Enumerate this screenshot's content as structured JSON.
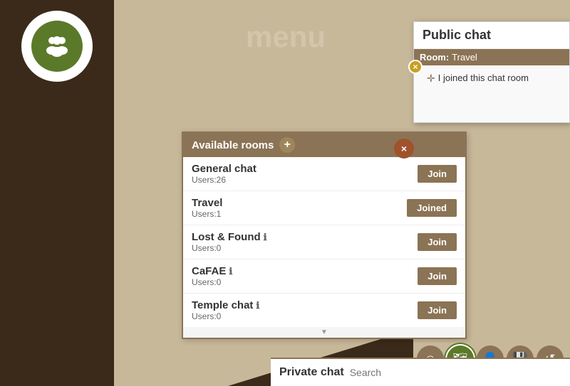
{
  "sidebar": {
    "logo_alt": "chat group icon"
  },
  "menu": {
    "title": "menu"
  },
  "public_chat": {
    "title": "Public chat",
    "room_label": "Room:",
    "room_name": "Travel",
    "message": "I joined this chat room",
    "close_x": "×",
    "dismiss_x": "×"
  },
  "rooms": {
    "header": "Available rooms",
    "add_icon": "+",
    "items": [
      {
        "name": "General chat",
        "users": "Users:26",
        "action": "Join",
        "joined": false,
        "info": false
      },
      {
        "name": "Travel",
        "users": "Users:1",
        "action": "Joined",
        "joined": true,
        "info": false
      },
      {
        "name": "Lost & Found",
        "users": "Users:0",
        "action": "Join",
        "joined": false,
        "info": true
      },
      {
        "name": "CaFAE",
        "users": "Users:0",
        "action": "Join",
        "joined": false,
        "info": true
      },
      {
        "name": "Temple chat",
        "users": "Users:0",
        "action": "Join",
        "joined": false,
        "info": true
      }
    ],
    "scroll_indicator": "▼"
  },
  "toolbar": {
    "buttons": [
      {
        "icon": "☺",
        "name": "emoji-button",
        "active": false
      },
      {
        "icon": "🗺",
        "name": "map-button",
        "active": true
      },
      {
        "icon": "👤",
        "name": "profile-button",
        "active": false
      },
      {
        "icon": "💾",
        "name": "save-button",
        "active": false
      },
      {
        "icon": "↺",
        "name": "refresh-button",
        "active": false
      }
    ]
  },
  "private_chat": {
    "label": "Private chat",
    "search_placeholder": "Search"
  }
}
